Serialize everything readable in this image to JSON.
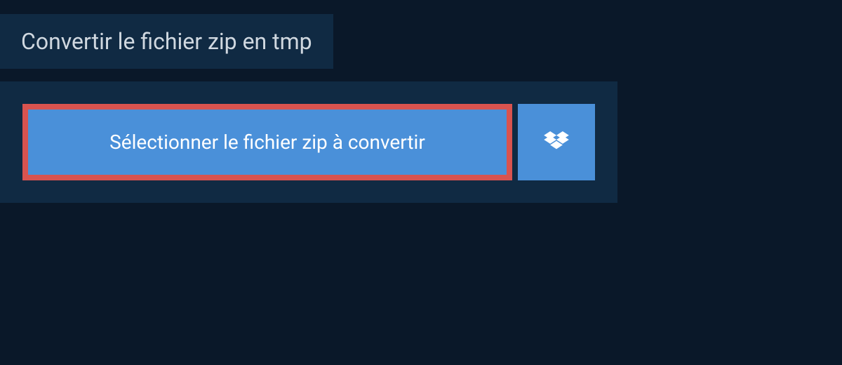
{
  "tab": {
    "label": "Convertir le fichier zip en tmp"
  },
  "actions": {
    "select_file_label": "Sélectionner le fichier zip à convertir"
  }
}
